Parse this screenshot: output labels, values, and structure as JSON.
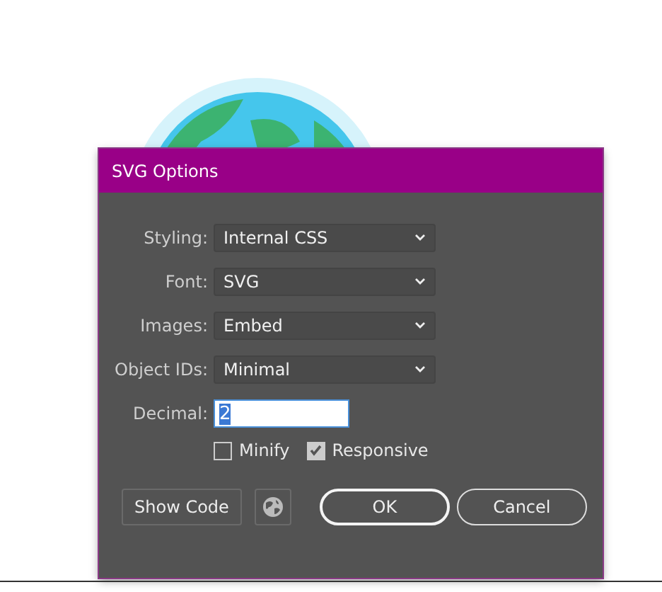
{
  "dialog": {
    "title": "SVG Options",
    "fields": [
      {
        "kind": "select",
        "label": "Styling:",
        "value": "Internal CSS"
      },
      {
        "kind": "select",
        "label": "Font:",
        "value": "SVG"
      },
      {
        "kind": "select",
        "label": "Images:",
        "value": "Embed"
      },
      {
        "kind": "select",
        "label": "Object IDs:",
        "value": "Minimal"
      },
      {
        "kind": "text",
        "label": "Decimal:",
        "value": "2",
        "text_selected": true
      }
    ],
    "checkboxes": [
      {
        "label": "Minify",
        "checked": false
      },
      {
        "label": "Responsive",
        "checked": true
      }
    ],
    "buttons": [
      {
        "kind": "plain",
        "label": "Show Code"
      },
      {
        "kind": "icon"
      },
      {
        "kind": "pill",
        "label": "OK",
        "default": true
      },
      {
        "kind": "pill",
        "label": "Cancel",
        "default": false
      }
    ]
  }
}
